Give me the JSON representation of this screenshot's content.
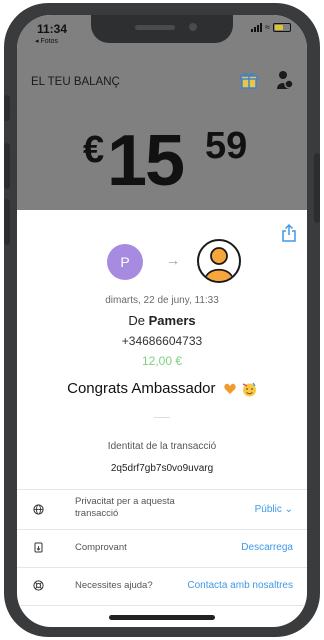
{
  "status_bar": {
    "time": "11:34",
    "back_label": "◂ Fotos"
  },
  "header": {
    "title": "EL TEU BALANÇ",
    "gift_icon": "gift-icon",
    "profile_icon": "profile-icon"
  },
  "balance": {
    "currency": "€",
    "whole": "15",
    "cents": "59"
  },
  "transaction": {
    "sender_initial": "P",
    "date": "dimarts, 22 de juny, 11:33",
    "from_prefix": "De",
    "from_name": "Pamers",
    "phone": "+34686604733",
    "amount": "12,00 €",
    "message": "Congrats Ambassador",
    "id_label": "Identitat de la transacció",
    "id_value": "2q5drf7gb7s0vo9uvarg"
  },
  "rows": {
    "privacy": {
      "label": "Privacitat per a aquesta transacció",
      "action": "Públic ⌄"
    },
    "receipt": {
      "label": "Comprovant",
      "action": "Descarrega"
    },
    "help": {
      "label": "Necessites ajuda?",
      "action": "Contacta amb nosaltres"
    }
  },
  "colors": {
    "header_bg": "#808080",
    "accent_blue": "#3f98e6",
    "amount_green": "#7ed07e",
    "avatar_purple": "#a78be0"
  }
}
